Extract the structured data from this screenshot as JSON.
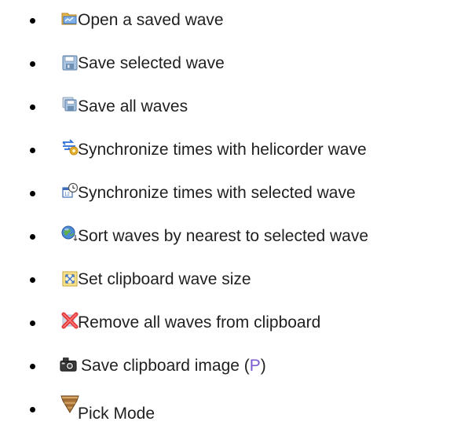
{
  "items": [
    {
      "label": "Open a saved wave",
      "icon": "open-folder-icon"
    },
    {
      "label": "Save selected wave",
      "icon": "floppy-disk-icon"
    },
    {
      "label": "Save all waves",
      "icon": "multiple-floppy-icon"
    },
    {
      "label": "Synchronize times with helicorder wave",
      "icon": "sync-helicorder-icon"
    },
    {
      "label": "Synchronize times with selected wave",
      "icon": "sync-calendar-clock-icon"
    },
    {
      "label": "Sort waves by nearest to selected wave",
      "icon": "globe-sort-icon"
    },
    {
      "label": "Set clipboard wave size",
      "icon": "resize-frame-icon"
    },
    {
      "label": "Remove all waves from clipboard",
      "icon": "red-x-remove-icon"
    },
    {
      "label": "Save clipboard image (",
      "hotkey": "P",
      "label_end": ")",
      "icon": "camera-icon"
    },
    {
      "label": "Pick Mode",
      "icon": "pick-shield-icon"
    }
  ]
}
